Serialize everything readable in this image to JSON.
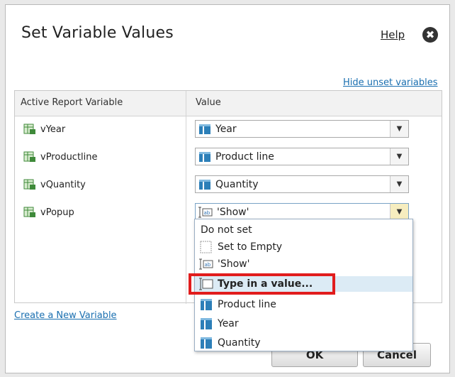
{
  "dialog": {
    "title": "Set Variable Values",
    "help_label": "Help",
    "close_glyph": "✖",
    "hide_unset_label": "Hide unset variables",
    "create_variable_label": "Create a New Variable"
  },
  "table": {
    "headers": [
      "Active Report Variable",
      "Value"
    ],
    "rows": [
      {
        "variable": "vYear",
        "value": "Year",
        "value_icon": "field-icon"
      },
      {
        "variable": "vProductline",
        "value": "Product line",
        "value_icon": "field-icon"
      },
      {
        "variable": "vQuantity",
        "value": "Quantity",
        "value_icon": "field-icon"
      },
      {
        "variable": "vPopup",
        "value": "'Show'",
        "value_icon": "text-value-icon"
      }
    ]
  },
  "dropdown": {
    "options": [
      {
        "label": "Do not set",
        "icon": "none"
      },
      {
        "label": "Set to Empty",
        "icon": "empty-icon"
      },
      {
        "label": "'Show'",
        "icon": "text-value-icon"
      },
      {
        "label": "Type in a value...",
        "icon": "type-value-icon",
        "highlighted": true
      },
      {
        "label": "Product line",
        "icon": "field-icon"
      },
      {
        "label": "Year",
        "icon": "field-icon"
      },
      {
        "label": "Quantity",
        "icon": "field-icon"
      }
    ]
  },
  "buttons": {
    "ok_label": "OK",
    "cancel_label": "Cancel"
  },
  "colors": {
    "link": "#1a6fb0",
    "highlight_row": "#dcebf5",
    "annotation_box": "#e11d1d",
    "field_icon": "#2c7fb8"
  }
}
